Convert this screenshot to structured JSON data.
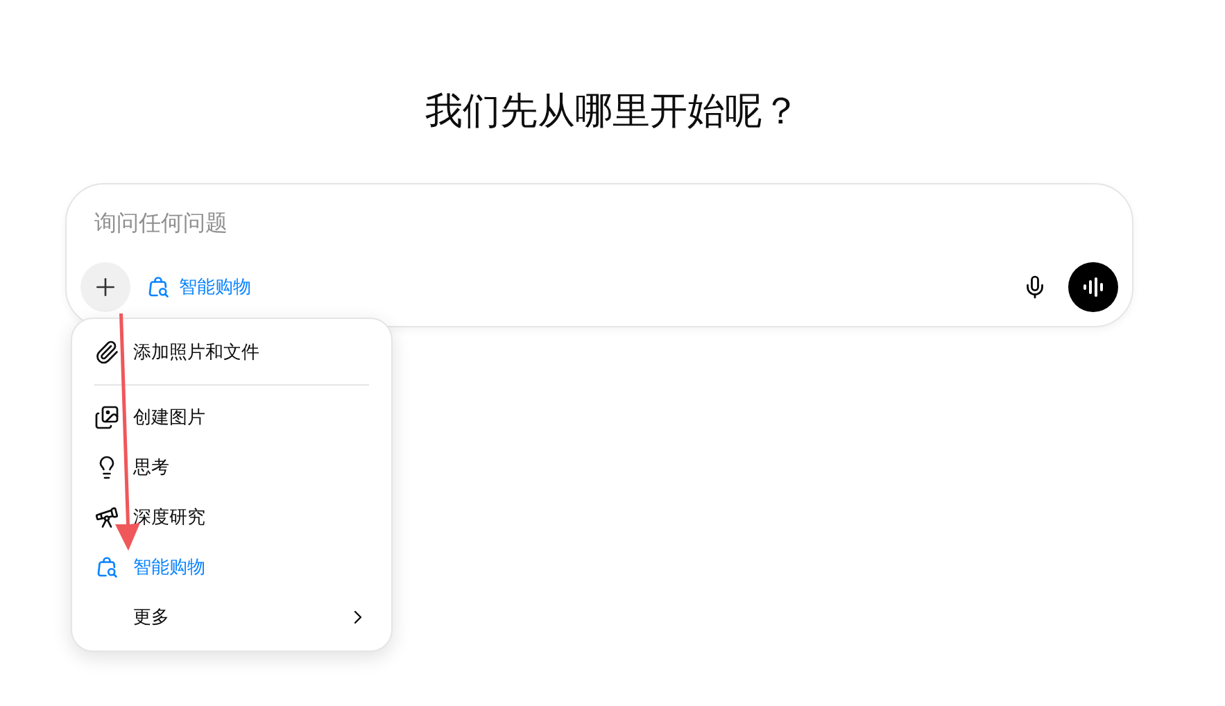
{
  "heading": "我们先从哪里开始呢？",
  "composer": {
    "placeholder": "询问任何问题",
    "tool_chip": "智能购物"
  },
  "menu": {
    "items": [
      {
        "kind": "attach",
        "label": "添加照片和文件",
        "selected": false
      },
      {
        "kind": "divider"
      },
      {
        "kind": "image",
        "label": "创建图片",
        "selected": false
      },
      {
        "kind": "think",
        "label": "思考",
        "selected": false
      },
      {
        "kind": "research",
        "label": "深度研究",
        "selected": false
      },
      {
        "kind": "shopping",
        "label": "智能购物",
        "selected": true
      },
      {
        "kind": "more",
        "label": "更多",
        "selected": false
      }
    ]
  }
}
